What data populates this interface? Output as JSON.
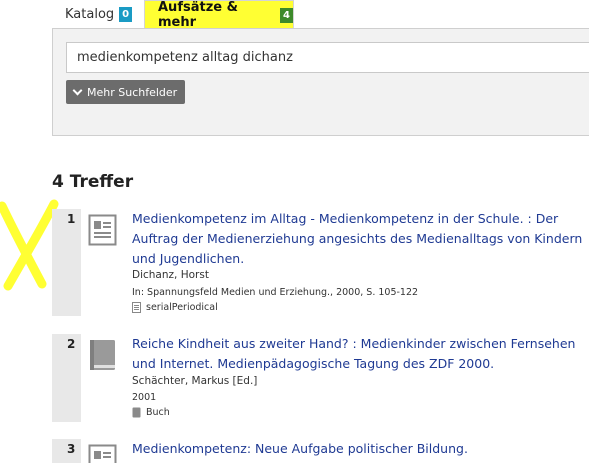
{
  "tabs": [
    {
      "label": "Katalog",
      "count": "0"
    },
    {
      "label": "Aufsätze & mehr",
      "count": "4"
    }
  ],
  "search": {
    "value": "medienkompetenz alltag dichanz",
    "more_fields_label": "Mehr Suchfelder"
  },
  "results_heading": "4 Treffer",
  "results": [
    {
      "number": "1",
      "title": "Medienkompetenz im Alltag - Medienkompetenz in der Schule. : Der Auftrag der Medienerziehung angesichts des Medienalltags von Kindern und Jugendlichen.",
      "author": "Dichanz, Horst",
      "source": "In: Spannungsfeld Medien und Erziehung., 2000, S. 105-122",
      "format": "serialPeriodical",
      "icon": "article-icon"
    },
    {
      "number": "2",
      "title": "Reiche Kindheit aus zweiter Hand? : Medienkinder zwischen Fernsehen und Internet. Medienpädagogische Tagung des ZDF 2000.",
      "author": "Schächter, Markus [Ed.]",
      "year": "2001",
      "format": "Buch",
      "icon": "book-icon"
    },
    {
      "number": "3",
      "title": "Medienkompetenz: Neue Aufgabe politischer Bildung.",
      "icon": "article-icon"
    }
  ],
  "colors": {
    "highlight": "#ffff33",
    "link": "#1f3a93",
    "count_blue": "#1a9bc4",
    "count_green": "#3d8a2a"
  }
}
